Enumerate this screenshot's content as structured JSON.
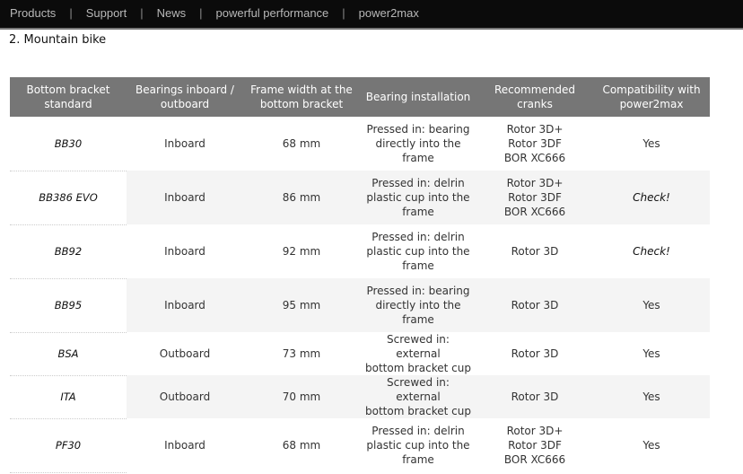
{
  "nav": {
    "items": [
      "Products",
      "Support",
      "News",
      "powerful performance",
      "power2max"
    ],
    "separator": "|"
  },
  "section": {
    "title": "2. Mountain bike"
  },
  "table": {
    "columns": [
      "Bottom bracket standard",
      "Bearings inboard / outboard",
      "Frame width at the bottom bracket",
      "Bearing installation",
      "Recommended cranks",
      "Compatibility with power2max"
    ],
    "rows": [
      {
        "standard": "BB30",
        "bearings": "Inboard",
        "width": "68 mm",
        "installation": [
          "Pressed in: bearing",
          "directly into the",
          "frame"
        ],
        "cranks": [
          "Rotor 3D+",
          "Rotor 3DF",
          "BOR XC666"
        ],
        "compat": "Yes",
        "compat_emphasis": false
      },
      {
        "standard": "BB386 EVO",
        "bearings": "Inboard",
        "width": "86 mm",
        "installation": [
          "Pressed in: delrin",
          "plastic cup into the",
          "frame"
        ],
        "cranks": [
          "Rotor 3D+",
          "Rotor 3DF",
          "BOR XC666"
        ],
        "compat": "Check!",
        "compat_emphasis": true
      },
      {
        "standard": "BB92",
        "bearings": "Inboard",
        "width": "92 mm",
        "installation": [
          "Pressed in: delrin",
          "plastic cup into the",
          "frame"
        ],
        "cranks": [
          "Rotor 3D"
        ],
        "compat": "Check!",
        "compat_emphasis": true
      },
      {
        "standard": "BB95",
        "bearings": "Inboard",
        "width": "95 mm",
        "installation": [
          "Pressed in: bearing",
          "directly into the",
          "frame"
        ],
        "cranks": [
          "Rotor 3D"
        ],
        "compat": "Yes",
        "compat_emphasis": false
      },
      {
        "standard": "BSA",
        "bearings": "Outboard",
        "width": "73 mm",
        "installation": [
          "Screwed in: external",
          "bottom bracket cup"
        ],
        "cranks": [
          "Rotor 3D"
        ],
        "compat": "Yes",
        "compat_emphasis": false
      },
      {
        "standard": "ITA",
        "bearings": "Outboard",
        "width": "70 mm",
        "installation": [
          "Screwed in: external",
          "bottom bracket cup"
        ],
        "cranks": [
          "Rotor 3D"
        ],
        "compat": "Yes",
        "compat_emphasis": false
      },
      {
        "standard": "PF30",
        "bearings": "Inboard",
        "width": "68 mm",
        "installation": [
          "Pressed in: delrin",
          "plastic cup into the",
          "frame"
        ],
        "cranks": [
          "Rotor 3D+",
          "Rotor 3DF",
          "BOR XC666"
        ],
        "compat": "Yes",
        "compat_emphasis": false
      }
    ]
  }
}
